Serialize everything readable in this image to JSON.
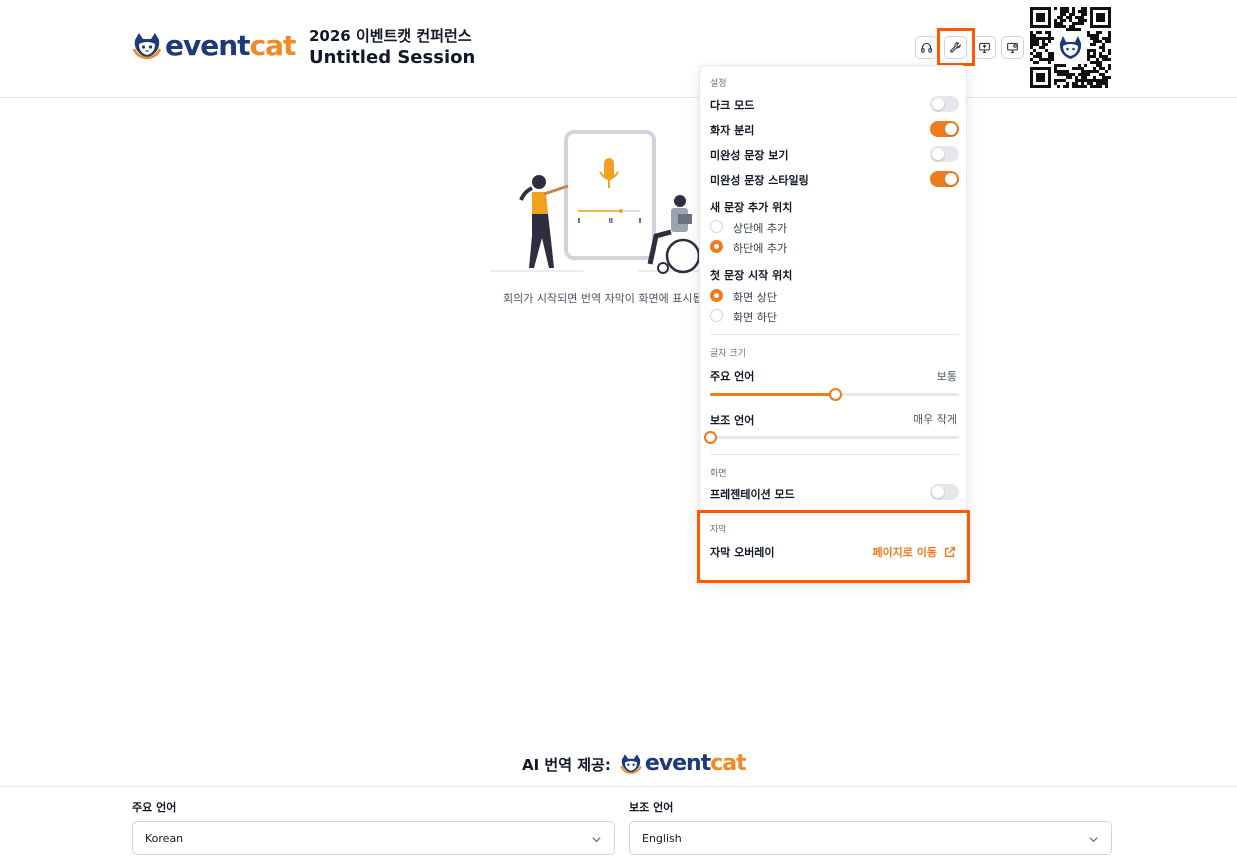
{
  "header": {
    "logo_ev": "event",
    "logo_cat": "cat",
    "event_name": "2026 이벤트캣 컨퍼런스",
    "session_name": "Untitled Session",
    "buttons": [
      {
        "name": "headphones-icon"
      },
      {
        "name": "wrench-icon"
      },
      {
        "name": "screen-share-icon"
      },
      {
        "name": "monitor-settings-icon"
      }
    ]
  },
  "empty_state": {
    "message": "회의가 시작되면 번역 자막이 화면에 표시됩니다."
  },
  "settings": {
    "section_settings": "설정",
    "dark_mode": {
      "label": "다크 모드",
      "on": false
    },
    "speaker_sep": {
      "label": "화자 분리",
      "on": true
    },
    "incomplete_view": {
      "label": "미완성 문장 보기",
      "on": false
    },
    "incomplete_style": {
      "label": "미완성 문장 스타일링",
      "on": true
    },
    "new_sentence_pos": {
      "label": "새 문장 추가 위치",
      "options": [
        "상단에 추가",
        "하단에 추가"
      ],
      "selected": 1
    },
    "first_sentence_pos": {
      "label": "첫 문장 시작 위치",
      "options": [
        "화면 상단",
        "화면 하단"
      ],
      "selected": 0
    },
    "section_font": "글자 크기",
    "primary_font": {
      "label": "주요 언어",
      "value_label": "보통",
      "level": 0.5
    },
    "secondary_font": {
      "label": "보조 언어",
      "value_label": "매우 작게",
      "level": 0.0
    },
    "section_screen": "화면",
    "presentation": {
      "label": "프레젠테이션 모드",
      "on": false
    },
    "section_caption": "자막",
    "caption_overlay": {
      "label": "자막 오버레이",
      "link": "페이지로 이동"
    }
  },
  "footer": {
    "powered_by": "AI 번역 제공:",
    "primary_lang_label": "주요 언어",
    "primary_lang_value": "Korean",
    "secondary_lang_label": "보조 언어",
    "secondary_lang_value": "English"
  },
  "colors": {
    "accent": "#f07a1e",
    "brand_navy": "#1e3a7b",
    "highlight": "#ff5a00"
  }
}
